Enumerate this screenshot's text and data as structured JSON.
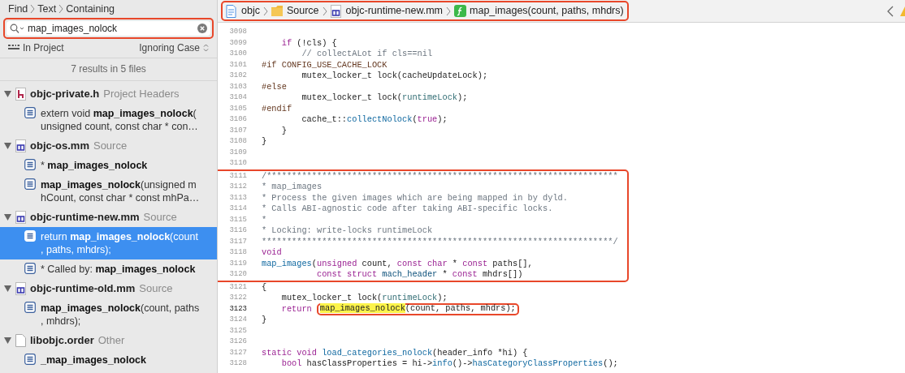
{
  "find_navigator": {
    "path": [
      "Find",
      "Text",
      "Containing"
    ],
    "search": {
      "value": "map_images_nolock",
      "annotated": true
    },
    "scope": "In Project",
    "matching": "Ignoring Case",
    "summary": "7 results in 5 files",
    "files": [
      {
        "name": "objc-private.h",
        "group": "Project Headers",
        "kind": "header",
        "expanded": true,
        "matches": [
          {
            "lines": [
              "extern void **map_images_nolock**(",
              "unsigned count, const char * con…"
            ],
            "selected": false
          }
        ]
      },
      {
        "name": "objc-os.mm",
        "group": "Source",
        "kind": "source",
        "expanded": true,
        "matches": [
          {
            "lines": [
              "* **map_images_nolock**"
            ],
            "selected": false
          },
          {
            "lines": [
              "**map_images_nolock**(unsigned m",
              "hCount, const char * const mhPa…"
            ],
            "selected": false
          }
        ]
      },
      {
        "name": "objc-runtime-new.mm",
        "group": "Source",
        "kind": "source",
        "expanded": true,
        "matches": [
          {
            "lines": [
              "return **map_images_nolock**(count",
              ", paths, mhdrs);"
            ],
            "selected": true
          },
          {
            "lines": [
              "* Called by: **map_images_nolock**"
            ],
            "selected": false
          }
        ]
      },
      {
        "name": "objc-runtime-old.mm",
        "group": "Source",
        "kind": "source",
        "expanded": true,
        "matches": [
          {
            "lines": [
              "**map_images_nolock**(count, paths",
              ", mhdrs);"
            ],
            "selected": false
          }
        ]
      },
      {
        "name": "libobjc.order",
        "group": "Other",
        "kind": "other",
        "expanded": true,
        "matches": [
          {
            "lines": [
              "**_map_images_nolock**"
            ],
            "selected": false
          }
        ]
      }
    ]
  },
  "editor": {
    "jump_bar": {
      "annotated": true,
      "items": [
        {
          "label": "objc",
          "kind": "project"
        },
        {
          "label": "Source",
          "kind": "folder"
        },
        {
          "label": "objc-runtime-new.mm",
          "kind": "source"
        },
        {
          "label": "map_images(count, paths, mhdrs)",
          "kind": "function"
        }
      ]
    },
    "sections": [
      {
        "boxed": false,
        "lines": [
          {
            "number": "3098"
          },
          {
            "number": "3099",
            "segments": [
              {
                "t": "    if",
                "kind": "kw"
              },
              {
                "t": " (!cls) {"
              }
            ]
          },
          {
            "number": "3100",
            "segments": [
              {
                "t": "        // collectALot if cls==nil",
                "kind": "comment"
              }
            ]
          },
          {
            "number": "3101",
            "segments": [
              {
                "t": "#if CONFIG_USE_CACHE_LOCK",
                "kind": "pp"
              }
            ]
          },
          {
            "number": "3102",
            "segments": [
              {
                "t": "        mutex_locker_t lock(cacheUpdateLock);"
              }
            ]
          },
          {
            "number": "3103",
            "segments": [
              {
                "t": "#else",
                "kind": "pp"
              }
            ]
          },
          {
            "number": "3104",
            "segments": [
              {
                "t": "        mutex_locker_t lock("
              },
              {
                "t": "runtimeLock",
                "kind": "var"
              },
              {
                "t": ");"
              }
            ]
          },
          {
            "number": "3105",
            "segments": [
              {
                "t": "#endif",
                "kind": "pp"
              }
            ]
          },
          {
            "number": "3106",
            "segments": [
              {
                "t": "        cache_t::"
              },
              {
                "t": "collectNolock",
                "kind": "fn"
              },
              {
                "t": "("
              },
              {
                "t": "true",
                "kind": "kw"
              },
              {
                "t": ");"
              }
            ]
          },
          {
            "number": "3107",
            "segments": [
              {
                "t": "    }"
              }
            ]
          },
          {
            "number": "3108",
            "segments": [
              {
                "t": "}"
              }
            ]
          },
          {
            "number": "3109"
          },
          {
            "number": "3110"
          }
        ]
      },
      {
        "boxed": true,
        "lines": [
          {
            "number": "3111",
            "segments": [
              {
                "t": "/**********************************************************************",
                "kind": "comment"
              }
            ]
          },
          {
            "number": "3112",
            "segments": [
              {
                "t": "* map_images",
                "kind": "comment"
              }
            ]
          },
          {
            "number": "3113",
            "segments": [
              {
                "t": "* Process the given images which are being mapped in by dyld.",
                "kind": "comment"
              }
            ]
          },
          {
            "number": "3114",
            "segments": [
              {
                "t": "* Calls ABI-agnostic code after taking ABI-specific locks.",
                "kind": "comment"
              }
            ]
          },
          {
            "number": "3115",
            "segments": [
              {
                "t": "*",
                "kind": "comment"
              }
            ]
          },
          {
            "number": "3116",
            "segments": [
              {
                "t": "* Locking: write-locks runtimeLock",
                "kind": "comment"
              }
            ]
          },
          {
            "number": "3117",
            "segments": [
              {
                "t": "**********************************************************************/",
                "kind": "comment"
              }
            ]
          },
          {
            "number": "3118",
            "segments": [
              {
                "t": "void",
                "kind": "kw"
              }
            ]
          },
          {
            "number": "3119",
            "segments": [
              {
                "t": "map_images",
                "kind": "fn"
              },
              {
                "t": "("
              },
              {
                "t": "unsigned",
                "kind": "kw"
              },
              {
                "t": " count, "
              },
              {
                "t": "const char",
                "kind": "kw"
              },
              {
                "t": " * "
              },
              {
                "t": "const",
                "kind": "kw"
              },
              {
                "t": " paths[],"
              }
            ]
          },
          {
            "number": "3120",
            "segments": [
              {
                "t": "           const struct",
                "kind": "kw"
              },
              {
                "t": " mach_header",
                "kind": "type"
              },
              {
                "t": " * "
              },
              {
                "t": "const",
                "kind": "kw"
              },
              {
                "t": " mhdrs[])"
              }
            ]
          }
        ]
      },
      {
        "boxed": false,
        "lines": [
          {
            "number": "3121",
            "segments": [
              {
                "t": "{"
              }
            ]
          },
          {
            "number": "3122",
            "segments": [
              {
                "t": "    mutex_locker_t lock("
              },
              {
                "t": "runtimeLock",
                "kind": "var"
              },
              {
                "t": ");"
              }
            ]
          },
          {
            "number": "3123",
            "current": true,
            "segments": [
              {
                "t": "    return",
                "kind": "kw"
              },
              {
                "t": "map_images_nolock",
                "kind": "match",
                "boxed": true
              },
              {
                "t": "(count, paths, mhdrs);",
                "boxed": true
              }
            ]
          },
          {
            "number": "3124",
            "segments": [
              {
                "t": "}"
              }
            ]
          },
          {
            "number": "3125"
          },
          {
            "number": "3126"
          },
          {
            "number": "3127",
            "segments": [
              {
                "t": "static void",
                "kind": "kw"
              },
              {
                "t": " load_categories_nolock",
                "kind": "fn"
              },
              {
                "t": "(header_info *hi) {"
              }
            ]
          },
          {
            "number": "3128",
            "segments": [
              {
                "t": "    bool",
                "kind": "kw"
              },
              {
                "t": " hasClassProperties = hi->"
              },
              {
                "t": "info",
                "kind": "fn"
              },
              {
                "t": "()->"
              },
              {
                "t": "hasCategoryClassProperties",
                "kind": "fn"
              },
              {
                "t": "();"
              }
            ]
          }
        ]
      }
    ]
  }
}
